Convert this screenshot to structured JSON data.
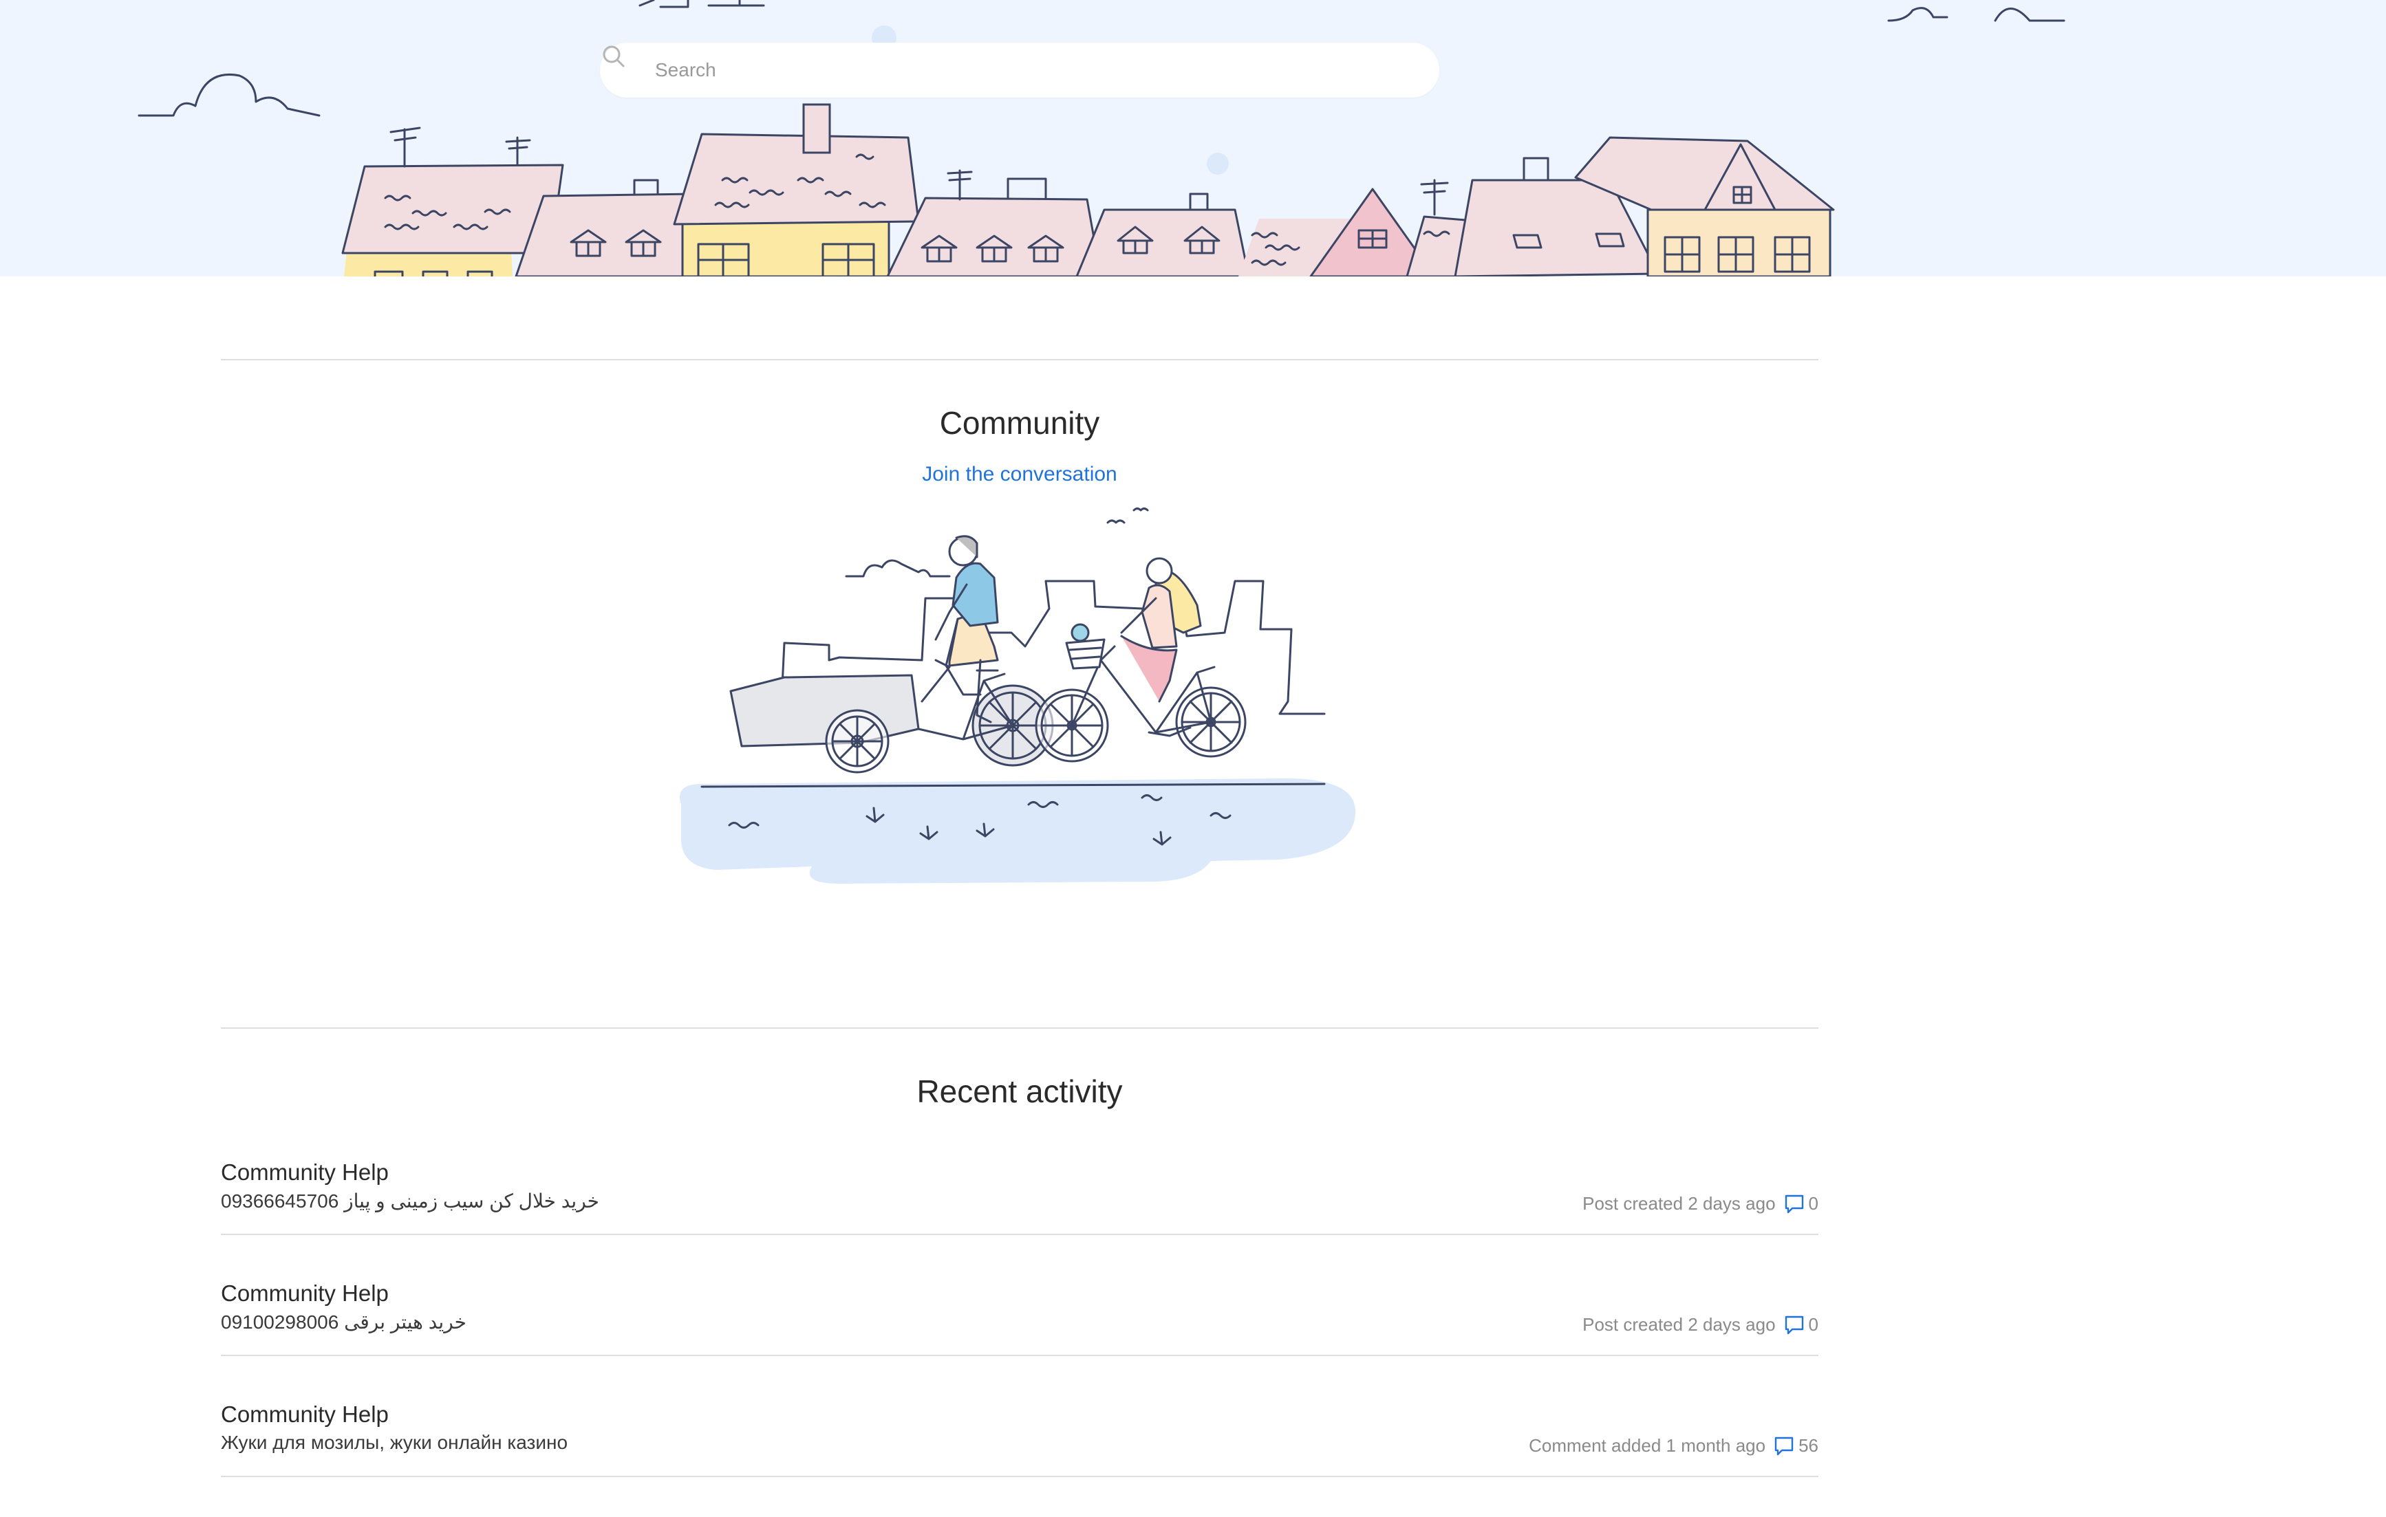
{
  "search": {
    "placeholder": "Search"
  },
  "community": {
    "title": "Community",
    "link_label": "Join the conversation"
  },
  "recent_activity": {
    "title": "Recent activity",
    "items": [
      {
        "community": "Community Help",
        "post_title": "خرید خلال کن سیب زمینی و پیاز 09366645706",
        "meta": "Post created 2 days ago",
        "comments": "0"
      },
      {
        "community": "Community Help",
        "post_title": "خرید هیتر برقی 09100298006",
        "meta": "Post created 2 days ago",
        "comments": "0"
      },
      {
        "community": "Community Help",
        "post_title": "Жуки для мозилы, жуки онлайн казино",
        "meta": "Comment added 1 month ago",
        "comments": "56"
      }
    ]
  },
  "colors": {
    "hero_bg": "#eef5fe",
    "link": "#1f73da",
    "roof_pink": "#f2dde0",
    "wall_yellow": "#fce9a3",
    "water_blue": "#dbe9fa",
    "line": "#3c4664"
  }
}
